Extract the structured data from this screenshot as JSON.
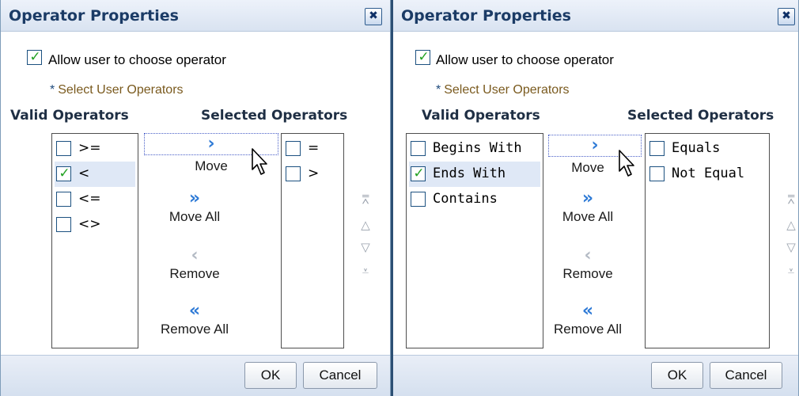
{
  "dialogs": [
    {
      "title": "Operator Properties",
      "close_icon": "close-icon",
      "allow_label": "Allow user to choose operator",
      "allow_checked": true,
      "required_marker": "*",
      "select_user_label": "Select User Operators",
      "valid_header": "Valid Operators",
      "selected_header": "Selected Operators",
      "valid_items": [
        {
          "label": ">=",
          "checked": false,
          "selected": false
        },
        {
          "label": "<",
          "checked": true,
          "selected": true
        },
        {
          "label": "<=",
          "checked": false,
          "selected": false
        },
        {
          "label": "<>",
          "checked": false,
          "selected": false
        }
      ],
      "selected_items": [
        {
          "label": "=",
          "checked": false
        },
        {
          "label": ">",
          "checked": false
        }
      ],
      "move_label": "Move",
      "move_all_label": "Move All",
      "remove_label": "Remove",
      "remove_all_label": "Remove All",
      "ok_label": "OK",
      "cancel_label": "Cancel"
    },
    {
      "title": "Operator Properties",
      "close_icon": "close-icon",
      "allow_label": "Allow user to choose operator",
      "allow_checked": true,
      "required_marker": "*",
      "select_user_label": "Select User Operators",
      "valid_header": "Valid Operators",
      "selected_header": "Selected Operators",
      "valid_items": [
        {
          "label": "Begins With",
          "checked": false,
          "selected": false
        },
        {
          "label": "Ends With",
          "checked": true,
          "selected": true
        },
        {
          "label": "Contains",
          "checked": false,
          "selected": false
        }
      ],
      "selected_items": [
        {
          "label": "Equals",
          "checked": false
        },
        {
          "label": "Not Equal",
          "checked": false
        }
      ],
      "move_label": "Move",
      "move_all_label": "Move All",
      "remove_label": "Remove",
      "remove_all_label": "Remove All",
      "ok_label": "OK",
      "cancel_label": "Cancel"
    }
  ],
  "icons": {
    "move": "›",
    "move_all": "»",
    "remove": "‹",
    "remove_all": "«",
    "check": "✓",
    "close": "✖",
    "move_top": "⩞",
    "move_up": "△",
    "move_down": "▽",
    "move_bottom": "⩡"
  },
  "colors": {
    "title_text": "#1b3b66",
    "selected_row": "#dfe8f6",
    "check_green": "#21a121",
    "shuttle_blue": "#2e7ad6",
    "disabled_gray": "#b3bac4",
    "link_brown": "#7a5a1e"
  }
}
